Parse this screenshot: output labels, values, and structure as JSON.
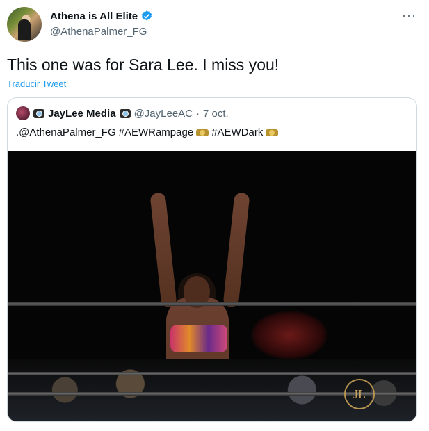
{
  "author": {
    "display_name": "Athena is All Elite",
    "handle": "@AthenaPalmer_FG",
    "verified_icon": "verified-badge-icon"
  },
  "more_label": "···",
  "tweet_text": "This one was for Sara Lee. I miss you!",
  "translate_label": "Traducir Tweet",
  "quoted": {
    "display_name": "JayLee Media",
    "handle": "@JayLeeAC",
    "separator": "·",
    "date": "7 oct.",
    "text_prefix": ".@AthenaPalmer_FG",
    "hashtag_1": "#AEWRampage",
    "hashtag_2": "#AEWDark",
    "photo_watermark": "JL"
  },
  "colors": {
    "link": "#1d9bf0",
    "secondary_text": "#536471",
    "verified": "#1d9bf0",
    "border": "#cfd9de"
  }
}
